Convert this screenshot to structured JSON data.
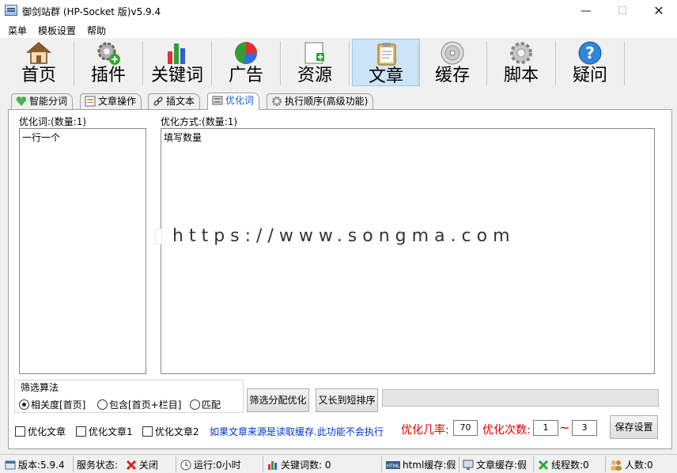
{
  "window": {
    "title": "御剑站群 (HP-Socket 版)v5.9.4",
    "minimize": "—",
    "maximize": "☐",
    "close": "✕"
  },
  "menu": [
    "菜单",
    "模板设置",
    "帮助"
  ],
  "toolbar": [
    {
      "label": "首页",
      "icon": "home-icon"
    },
    {
      "label": "插件",
      "icon": "plugin-gear-icon"
    },
    {
      "label": "关键词",
      "icon": "bar-chart-icon"
    },
    {
      "label": "广告",
      "icon": "pie-chart-icon"
    },
    {
      "label": "资源",
      "icon": "add-document-icon"
    },
    {
      "label": "文章",
      "icon": "clipboard-icon",
      "active": true
    },
    {
      "label": "缓存",
      "icon": "disc-icon"
    },
    {
      "label": "脚本",
      "icon": "gear-icon"
    },
    {
      "label": "疑问",
      "icon": "help-icon"
    }
  ],
  "tabs": [
    {
      "label": "智能分词",
      "icon": "heart-icon"
    },
    {
      "label": "文章操作",
      "icon": "document-icon"
    },
    {
      "label": "插文本",
      "icon": "link-icon"
    },
    {
      "label": "优化词",
      "icon": "database-icon",
      "active": true
    },
    {
      "label": "执行顺序(高级功能)",
      "icon": "gear-icon"
    }
  ],
  "optimize": {
    "words_label": "优化词:(数量:1)",
    "words_value": "一行一个",
    "method_label": "优化方式:(数量:1)",
    "method_value": "填写数量"
  },
  "filter": {
    "title": "筛选算法",
    "options": [
      {
        "label": "相关度[首页]",
        "selected": true
      },
      {
        "label": "包含[首页+栏目]",
        "selected": false
      },
      {
        "label": "匹配",
        "selected": false
      }
    ],
    "btn_filter": "筛选分配优化",
    "btn_sort": "又长到短排序",
    "progress": 0
  },
  "checks": [
    "优化文章",
    "优化文章1",
    "优化文章2"
  ],
  "note": "如果文章来源是读取缓存.此功能不会执行",
  "rate": {
    "label": "优化几率:",
    "value": "70",
    "count_label": "优化次数:",
    "count_min": "1",
    "tilde": "~",
    "count_max": "3",
    "save": "保存设置"
  },
  "status": {
    "version": "版本:5.9.4",
    "service_label": "服务状态:",
    "service_value": "关闭",
    "runtime": "运行:0小时",
    "keywords": "关键词数: 0",
    "html_cache": "html缓存:假",
    "article_cache": "文章缓存:假",
    "threads": "线程数:0",
    "people": "人数:0"
  },
  "watermark": "https://www.songma.com"
}
